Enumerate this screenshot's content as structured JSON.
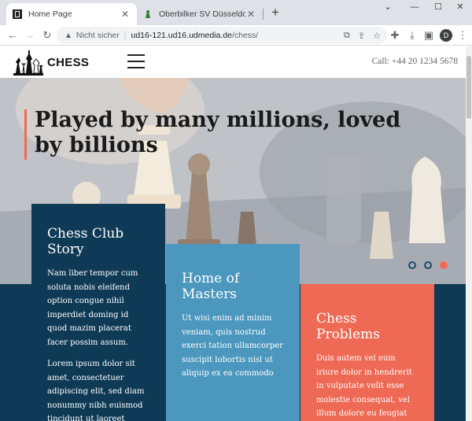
{
  "browser": {
    "tabs": [
      {
        "title": "Home Page",
        "active": true
      },
      {
        "title": "Oberbilker SV Düsseldorf - Ober",
        "active": false
      }
    ],
    "omnibox": {
      "security_label": "Nicht sicher",
      "host": "ud16-121.ud16.udmedia.de",
      "path": "/chess/"
    },
    "profile_initial": "D"
  },
  "site": {
    "logo_text": "CHESS",
    "phone": "Call: +44 20 1234 5678"
  },
  "hero": {
    "title": "Played by many millions, loved by billions",
    "slides_total": 3,
    "active_slide": 3
  },
  "cards": [
    {
      "title": "Chess Club Story",
      "paragraphs": [
        "Nam liber tempor cum soluta nobis eleifend option congue nihil imperdiet doming id quod mazim placerat facer possim assum.",
        "Lorem ipsum dolor sit amet, consectetuer adipiscing elit, sed diam nonummy nibh euismod tincidunt ut laoreet dolore"
      ]
    },
    {
      "title": "Home of Masters",
      "paragraphs": [
        "Ut wisi enim ad minim veniam, quis nostrud exerci tation ullamcorper suscipit lobortis nisl ut aliquip ex ea commodo"
      ]
    },
    {
      "title": "Chess Problems",
      "paragraphs": [
        "Duis autem vel eum iriure dolor in hendrerit in vulputate velit esse molestie consequat, vel illum dolore eu feugiat"
      ]
    }
  ],
  "colors": {
    "navy": "#0f3a56",
    "blue": "#4b97be",
    "coral": "#ef6a55"
  }
}
